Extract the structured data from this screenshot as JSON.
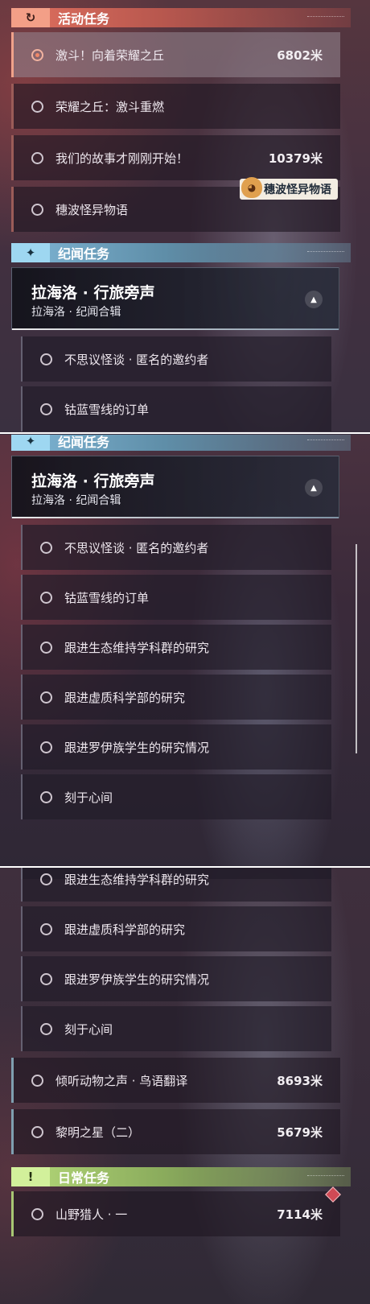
{
  "activity": {
    "title": "活动任务",
    "icon": "refresh-quest-icon",
    "items": [
      {
        "label": "激斗！向着荣耀之丘",
        "distance": "6802米",
        "selected": true
      },
      {
        "label": "荣耀之丘：激斗重燃",
        "distance": ""
      },
      {
        "label": "我们的故事才刚刚开始！",
        "distance": "10379米"
      },
      {
        "label": "穗波怪异物语",
        "distance": ""
      }
    ],
    "tooltip": "穗波怪异物语"
  },
  "chronicle": {
    "title": "纪闻任务",
    "icon": "sparkle-icon",
    "card_title": "拉海洛 · 行旅旁声",
    "card_subtitle": "拉海洛 · 纪闻合辑",
    "sub_items": [
      "不思议怪谈 · 匿名的邀约者",
      "钴蓝雪线的订单",
      "跟进生态维持学科群的研究",
      "跟进虚质科学部的研究",
      "跟进罗伊族学生的研究情况",
      "刻于心间"
    ],
    "partial_item": "钴蓝雪线的订单",
    "items": [
      {
        "label": "倾听动物之声 · 鸟语翻译",
        "distance": "8693米"
      },
      {
        "label": "黎明之星（二）",
        "distance": "5679米"
      }
    ]
  },
  "daily": {
    "title": "日常任务",
    "icon": "exclamation-icon",
    "items": [
      {
        "label": "山野猎人 · 一",
        "distance": "7114米"
      }
    ]
  },
  "colors": {
    "activity_accent": "#f39f87",
    "chronicle_accent": "#9ed7f1",
    "daily_accent": "#d2f09b"
  }
}
